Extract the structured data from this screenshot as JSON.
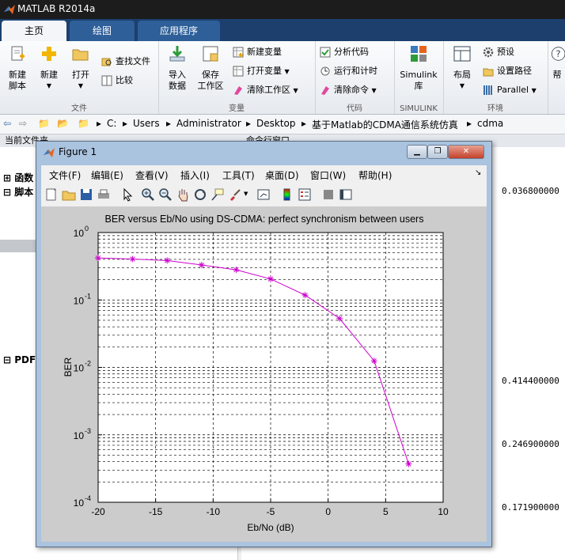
{
  "app": {
    "title": "MATLAB R2014a"
  },
  "tabs": [
    {
      "label": "主页",
      "active": true
    },
    {
      "label": "绘图",
      "active": false
    },
    {
      "label": "应用程序",
      "active": false
    }
  ],
  "ribbon": {
    "file_group": {
      "label": "文件",
      "new_script": "新建\n脚本",
      "new": "新建",
      "open": "打开",
      "find_files": "查找文件",
      "compare": "比较"
    },
    "variable_group": {
      "label": "变量",
      "import_data": "导入\n数据",
      "save_workspace": "保存\n工作区",
      "new_variable": "新建变量",
      "open_variable": "打开变量",
      "clear_workspace": "清除工作区"
    },
    "code_group": {
      "label": "代码",
      "analyze_code": "分析代码",
      "run_and_time": "运行和计时",
      "clear_commands": "清除命令"
    },
    "simulink_group": {
      "label": "SIMULINK",
      "simulink_library": "Simulink\n库"
    },
    "environment_group": {
      "label": "环境",
      "layout": "布局",
      "preferences": "预设",
      "set_path": "设置路径",
      "parallel": "Parallel"
    },
    "help_partial": "帮"
  },
  "address": {
    "segments": [
      "C:",
      "Users",
      "Administrator",
      "Desktop",
      "基于Matlab的CDMA通信系统仿真",
      "cdma"
    ]
  },
  "left_panel": {
    "header": "当前文件夹",
    "items": [
      "函数",
      "脚本",
      "PDF"
    ]
  },
  "right_panel": {
    "header": "命令行窗口",
    "numbers": [
      "0.036800000",
      "0.414400000",
      "0.246900000",
      "0.171900000"
    ]
  },
  "figure": {
    "title": "Figure 1",
    "menu": [
      "文件(F)",
      "编辑(E)",
      "查看(V)",
      "插入(I)",
      "工具(T)",
      "桌面(D)",
      "窗口(W)",
      "帮助(H)"
    ]
  },
  "colors": {
    "series": "#cc00cc",
    "ribbon_tab_bg": "#1c3f6e"
  },
  "chart_data": {
    "type": "line",
    "title": "BER versus Eb/No using DS-CDMA: perfect synchronism between users",
    "xlabel": "Eb/No (dB)",
    "ylabel": "BER",
    "xlim": [
      -20,
      10
    ],
    "ylim": [
      0.0001,
      1
    ],
    "yscale": "log",
    "grid": true,
    "xticks": [
      "-20",
      "-15",
      "-10",
      "-5",
      "0",
      "5",
      "10"
    ],
    "yticks": [
      {
        "base": "10",
        "exp": "0"
      },
      {
        "base": "10",
        "exp": "-1"
      },
      {
        "base": "10",
        "exp": "-2"
      },
      {
        "base": "10",
        "exp": "-3"
      },
      {
        "base": "10",
        "exp": "-4"
      }
    ],
    "x": [
      -20,
      -17,
      -14,
      -11,
      -8,
      -5,
      -2,
      1,
      4,
      7
    ],
    "y": [
      0.42,
      0.405,
      0.385,
      0.33,
      0.28,
      0.205,
      0.118,
      0.053,
      0.0125,
      0.00037
    ]
  }
}
